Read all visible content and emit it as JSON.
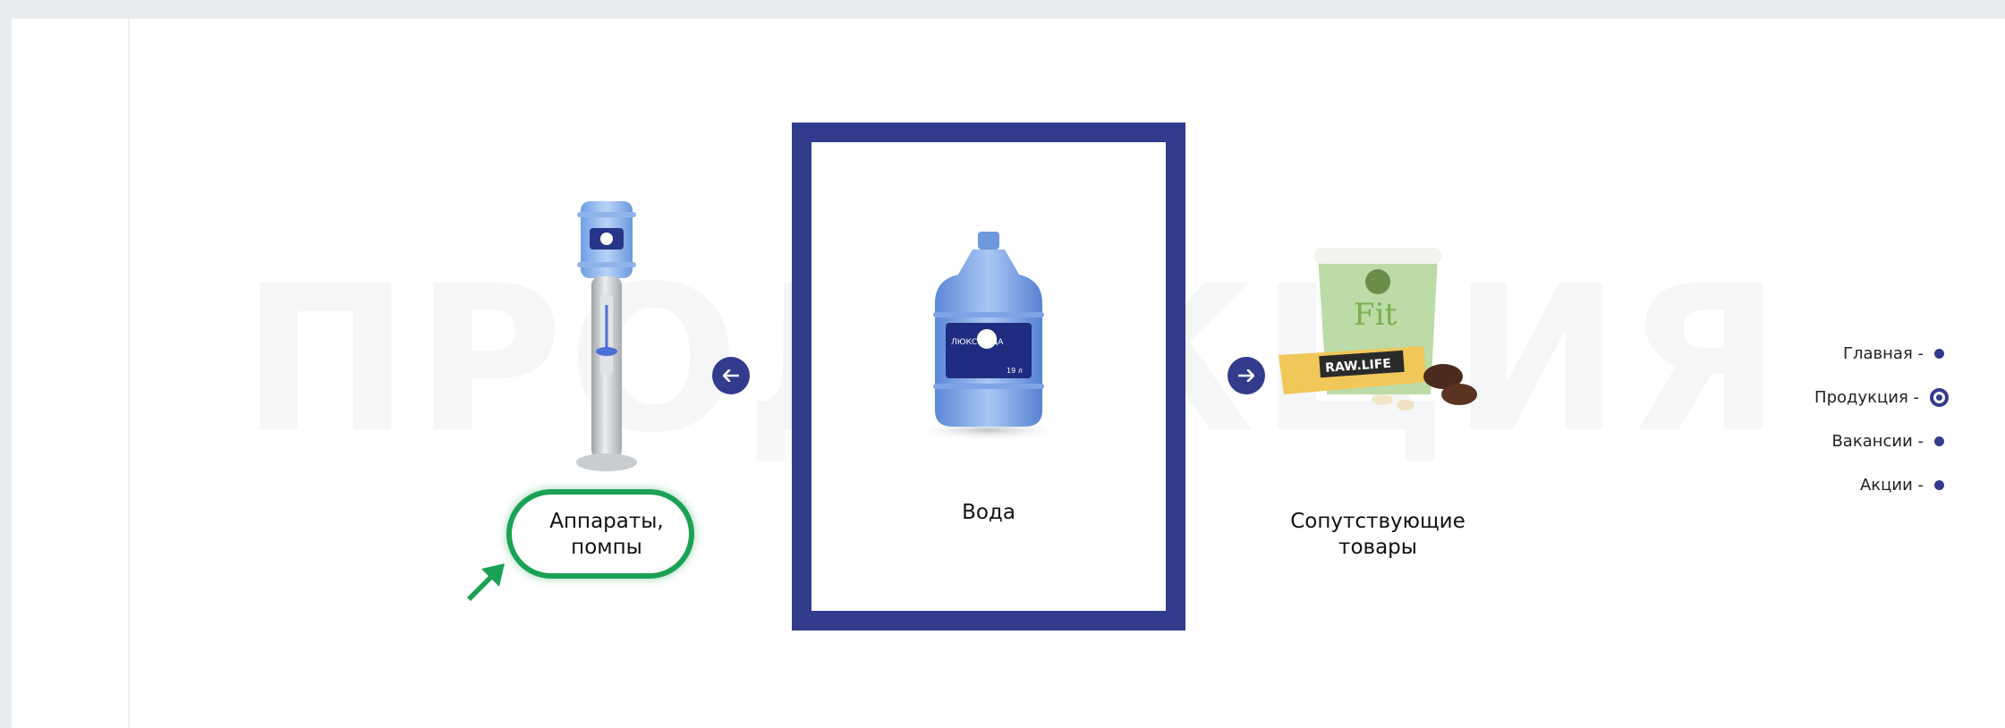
{
  "section": {
    "background_word": "ПРОДУКЦИЯ"
  },
  "carousel": {
    "items": [
      {
        "label_line1": "Аппараты,",
        "label_line2": "помпы",
        "image": "water-cooler-image"
      },
      {
        "label_line1": "Вода",
        "label_line2": "",
        "image": "water-bottle-image",
        "bottle_label": "ЛЮКС ВОДА",
        "bottle_volume": "19 л"
      },
      {
        "label_line1": "Сопутствующие",
        "label_line2": "товары",
        "image": "snacks-image",
        "snack_brand": "RAW.LIFE",
        "cup_text": "Fit"
      }
    ],
    "prev_icon": "arrow-left-icon",
    "next_icon": "arrow-right-icon",
    "active_index": 1
  },
  "side_nav": {
    "items": [
      {
        "label": "Главная -"
      },
      {
        "label": "Продукция -"
      },
      {
        "label": "Вакансии -"
      },
      {
        "label": "Акции -"
      }
    ],
    "active_index": 1
  },
  "colors": {
    "brand_navy": "#333b8c",
    "highlight_green": "#1aa155",
    "page_background": "#ffffff"
  }
}
